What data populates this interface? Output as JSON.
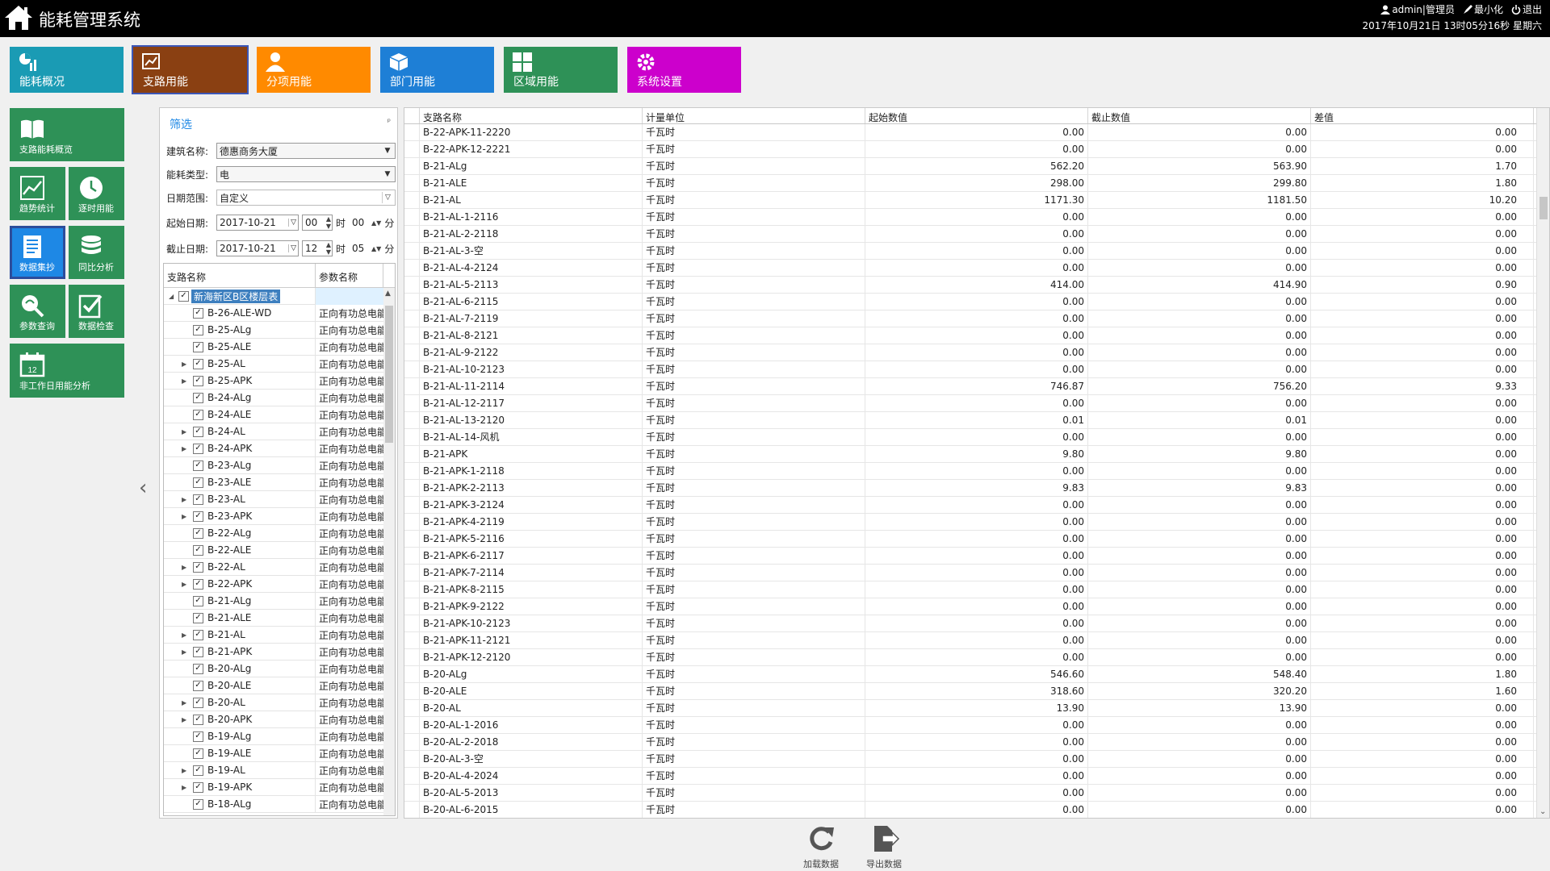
{
  "app": {
    "title": "能耗管理系统",
    "user_label": "admin|管理员",
    "minimize_label": "最小化",
    "exit_label": "退出",
    "datetime": "2017年10月21日 13时05分16秒 星期六"
  },
  "topnav": [
    {
      "label": "能耗概况",
      "color": "#1a9bb4",
      "icon": "dashboard-icon"
    },
    {
      "label": "支路用能",
      "color": "#8a4012",
      "icon": "branch-icon",
      "active": true
    },
    {
      "label": "分项用能",
      "color": "#ff8a00",
      "icon": "person-icon"
    },
    {
      "label": "部门用能",
      "color": "#1e7fd6",
      "icon": "box-icon"
    },
    {
      "label": "区域用能",
      "color": "#2e9157",
      "icon": "grid-icon"
    },
    {
      "label": "系统设置",
      "color": "#cc00cc",
      "icon": "gear-icon"
    }
  ],
  "sidebar": {
    "tiles": [
      {
        "label": "支路能耗概览",
        "icon": "book-icon"
      },
      {
        "label": "趋势统计",
        "icon": "trend-icon"
      },
      {
        "label": "逐时用能",
        "icon": "clock-icon"
      },
      {
        "label": "数据集抄",
        "icon": "document-icon",
        "active": true
      },
      {
        "label": "同比分析",
        "icon": "database-icon"
      },
      {
        "label": "参数查询",
        "icon": "query-icon"
      },
      {
        "label": "数据检查",
        "icon": "checklist-icon"
      },
      {
        "label": "非工作日用能分析",
        "icon": "calendar-icon",
        "calendar_day": "12"
      }
    ]
  },
  "filter": {
    "title": "筛选",
    "pin": "ᵖ",
    "building_label": "建筑名称:",
    "building_value": "德惠商务大厦",
    "energy_label": "能耗类型:",
    "energy_value": "电",
    "range_label": "日期范围:",
    "range_value": "自定义",
    "start_label": "起始日期:",
    "start_date": "2017-10-21",
    "start_hour": "00",
    "start_min": "00",
    "end_label": "截止日期:",
    "end_date": "2017-10-21",
    "end_hour": "12",
    "end_min": "05",
    "hour_unit": "时",
    "min_unit": "分"
  },
  "tree": {
    "col1": "支路名称",
    "col2": "参数名称",
    "root": "新海新区B区楼层表",
    "param": "正向有功总电能",
    "rows": [
      {
        "name": "B-26-ALE-WD",
        "exp": false
      },
      {
        "name": "B-25-ALg",
        "exp": false
      },
      {
        "name": "B-25-ALE",
        "exp": false
      },
      {
        "name": "B-25-AL",
        "exp": true
      },
      {
        "name": "B-25-APK",
        "exp": true
      },
      {
        "name": "B-24-ALg",
        "exp": false
      },
      {
        "name": "B-24-ALE",
        "exp": false
      },
      {
        "name": "B-24-AL",
        "exp": true
      },
      {
        "name": "B-24-APK",
        "exp": true
      },
      {
        "name": "B-23-ALg",
        "exp": false
      },
      {
        "name": "B-23-ALE",
        "exp": false
      },
      {
        "name": "B-23-AL",
        "exp": true
      },
      {
        "name": "B-23-APK",
        "exp": true
      },
      {
        "name": "B-22-ALg",
        "exp": false
      },
      {
        "name": "B-22-ALE",
        "exp": false
      },
      {
        "name": "B-22-AL",
        "exp": true
      },
      {
        "name": "B-22-APK",
        "exp": true
      },
      {
        "name": "B-21-ALg",
        "exp": false
      },
      {
        "name": "B-21-ALE",
        "exp": false
      },
      {
        "name": "B-21-AL",
        "exp": true
      },
      {
        "name": "B-21-APK",
        "exp": true
      },
      {
        "name": "B-20-ALg",
        "exp": false
      },
      {
        "name": "B-20-ALE",
        "exp": false
      },
      {
        "name": "B-20-AL",
        "exp": true
      },
      {
        "name": "B-20-APK",
        "exp": true
      },
      {
        "name": "B-19-ALg",
        "exp": false
      },
      {
        "name": "B-19-ALE",
        "exp": false
      },
      {
        "name": "B-19-AL",
        "exp": true
      },
      {
        "name": "B-19-APK",
        "exp": true
      },
      {
        "name": "B-18-ALg",
        "exp": false
      }
    ]
  },
  "grid": {
    "headers": [
      "支路名称",
      "计量单位",
      "起始数值",
      "截止数值",
      "差值"
    ],
    "unit": "千瓦时",
    "rows": [
      [
        "B-22-APK-11-2220",
        "0.00",
        "0.00",
        "0.00"
      ],
      [
        "B-22-APK-12-2221",
        "0.00",
        "0.00",
        "0.00"
      ],
      [
        "B-21-ALg",
        "562.20",
        "563.90",
        "1.70"
      ],
      [
        "B-21-ALE",
        "298.00",
        "299.80",
        "1.80"
      ],
      [
        "B-21-AL",
        "1171.30",
        "1181.50",
        "10.20"
      ],
      [
        "B-21-AL-1-2116",
        "0.00",
        "0.00",
        "0.00"
      ],
      [
        "B-21-AL-2-2118",
        "0.00",
        "0.00",
        "0.00"
      ],
      [
        "B-21-AL-3-空",
        "0.00",
        "0.00",
        "0.00"
      ],
      [
        "B-21-AL-4-2124",
        "0.00",
        "0.00",
        "0.00"
      ],
      [
        "B-21-AL-5-2113",
        "414.00",
        "414.90",
        "0.90"
      ],
      [
        "B-21-AL-6-2115",
        "0.00",
        "0.00",
        "0.00"
      ],
      [
        "B-21-AL-7-2119",
        "0.00",
        "0.00",
        "0.00"
      ],
      [
        "B-21-AL-8-2121",
        "0.00",
        "0.00",
        "0.00"
      ],
      [
        "B-21-AL-9-2122",
        "0.00",
        "0.00",
        "0.00"
      ],
      [
        "B-21-AL-10-2123",
        "0.00",
        "0.00",
        "0.00"
      ],
      [
        "B-21-AL-11-2114",
        "746.87",
        "756.20",
        "9.33"
      ],
      [
        "B-21-AL-12-2117",
        "0.00",
        "0.00",
        "0.00"
      ],
      [
        "B-21-AL-13-2120",
        "0.01",
        "0.01",
        "0.00"
      ],
      [
        "B-21-AL-14-风机",
        "0.00",
        "0.00",
        "0.00"
      ],
      [
        "B-21-APK",
        "9.80",
        "9.80",
        "0.00"
      ],
      [
        "B-21-APK-1-2118",
        "0.00",
        "0.00",
        "0.00"
      ],
      [
        "B-21-APK-2-2113",
        "9.83",
        "9.83",
        "0.00"
      ],
      [
        "B-21-APK-3-2124",
        "0.00",
        "0.00",
        "0.00"
      ],
      [
        "B-21-APK-4-2119",
        "0.00",
        "0.00",
        "0.00"
      ],
      [
        "B-21-APK-5-2116",
        "0.00",
        "0.00",
        "0.00"
      ],
      [
        "B-21-APK-6-2117",
        "0.00",
        "0.00",
        "0.00"
      ],
      [
        "B-21-APK-7-2114",
        "0.00",
        "0.00",
        "0.00"
      ],
      [
        "B-21-APK-8-2115",
        "0.00",
        "0.00",
        "0.00"
      ],
      [
        "B-21-APK-9-2122",
        "0.00",
        "0.00",
        "0.00"
      ],
      [
        "B-21-APK-10-2123",
        "0.00",
        "0.00",
        "0.00"
      ],
      [
        "B-21-APK-11-2121",
        "0.00",
        "0.00",
        "0.00"
      ],
      [
        "B-21-APK-12-2120",
        "0.00",
        "0.00",
        "0.00"
      ],
      [
        "B-20-ALg",
        "546.60",
        "548.40",
        "1.80"
      ],
      [
        "B-20-ALE",
        "318.60",
        "320.20",
        "1.60"
      ],
      [
        "B-20-AL",
        "13.90",
        "13.90",
        "0.00"
      ],
      [
        "B-20-AL-1-2016",
        "0.00",
        "0.00",
        "0.00"
      ],
      [
        "B-20-AL-2-2018",
        "0.00",
        "0.00",
        "0.00"
      ],
      [
        "B-20-AL-3-空",
        "0.00",
        "0.00",
        "0.00"
      ],
      [
        "B-20-AL-4-2024",
        "0.00",
        "0.00",
        "0.00"
      ],
      [
        "B-20-AL-5-2013",
        "0.00",
        "0.00",
        "0.00"
      ],
      [
        "B-20-AL-6-2015",
        "0.00",
        "0.00",
        "0.00"
      ]
    ]
  },
  "actions": {
    "load_label": "加载数据",
    "export_label": "导出数据"
  }
}
